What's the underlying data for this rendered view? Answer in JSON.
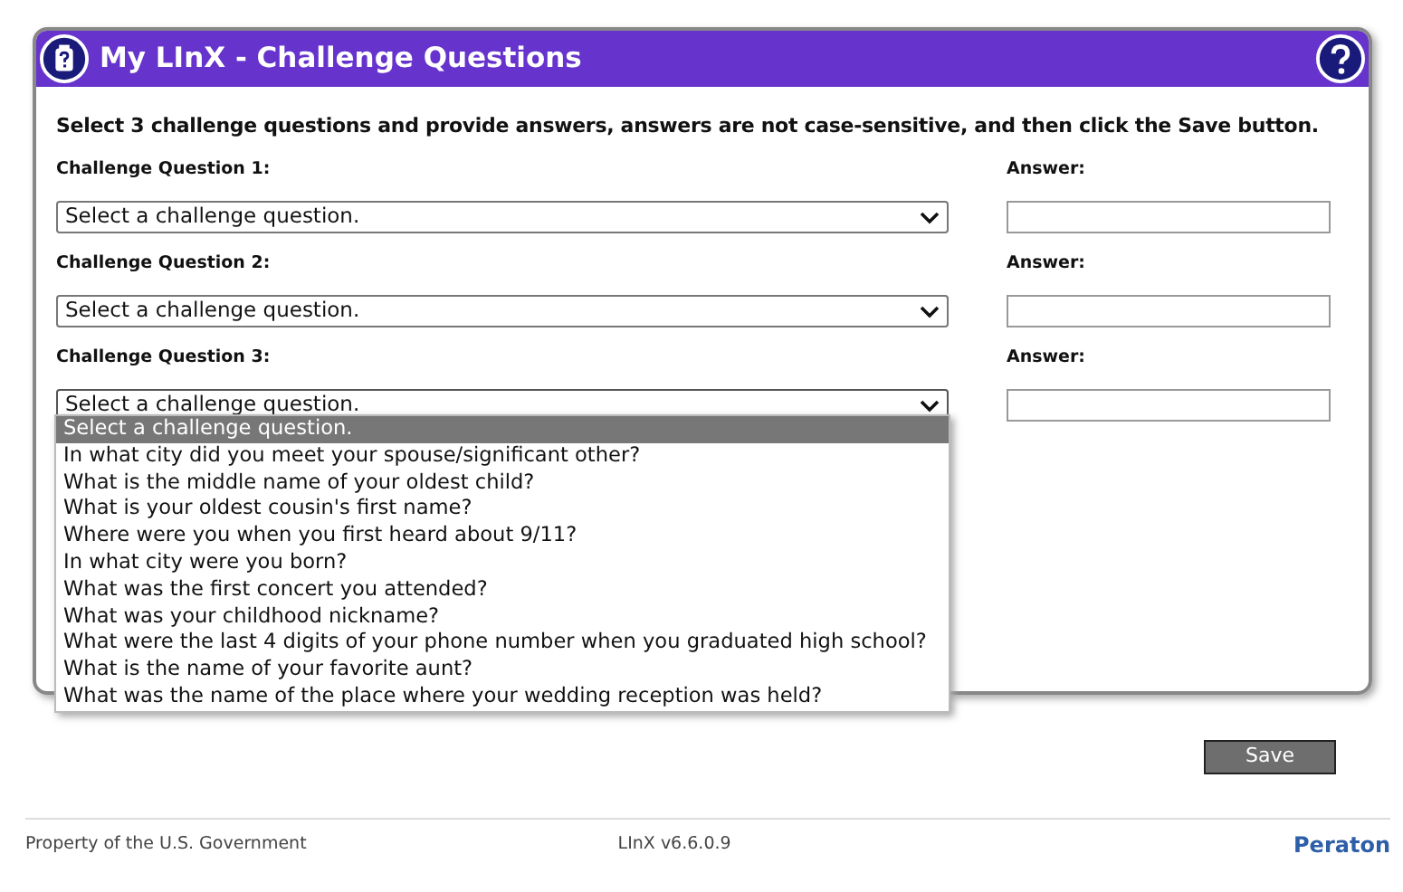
{
  "window": {
    "title": "My LInX - Challenge Questions"
  },
  "instruction": "Select 3 challenge questions and provide answers, answers are not case-sensitive, and then click the Save button.",
  "questions": [
    {
      "label": "Challenge Question 1:",
      "value": "Select a challenge question.",
      "answer_label": "Answer:",
      "expanded": false
    },
    {
      "label": "Challenge Question 2:",
      "value": "Select a challenge question.",
      "answer_label": "Answer:",
      "expanded": false
    },
    {
      "label": "Challenge Question 3:",
      "value": "Select a challenge question.",
      "answer_label": "Answer:",
      "expanded": true
    }
  ],
  "dropdown_options": [
    {
      "text": "Select a challenge question.",
      "selected": true
    },
    {
      "text": "In what city did you meet your spouse/significant other?",
      "selected": false
    },
    {
      "text": "What is the middle name of your oldest child?",
      "selected": false
    },
    {
      "text": "What is your oldest cousin's first name?",
      "selected": false
    },
    {
      "text": "Where were you when you first heard about 9/11?",
      "selected": false
    },
    {
      "text": "In what city were you born?",
      "selected": false
    },
    {
      "text": "What was the first concert you attended?",
      "selected": false
    },
    {
      "text": "What was your childhood nickname?",
      "selected": false
    },
    {
      "text": "What were the last 4 digits of your phone number when you graduated high school?",
      "selected": false
    },
    {
      "text": "What is the name of your favorite aunt?",
      "selected": false
    },
    {
      "text": "What was the name of the place where your wedding reception was held?",
      "selected": false
    }
  ],
  "save_button": "Save",
  "footer": {
    "left": "Property of the U.S. Government",
    "version": "LInX v6.6.0.9",
    "logo": "Peraton"
  }
}
